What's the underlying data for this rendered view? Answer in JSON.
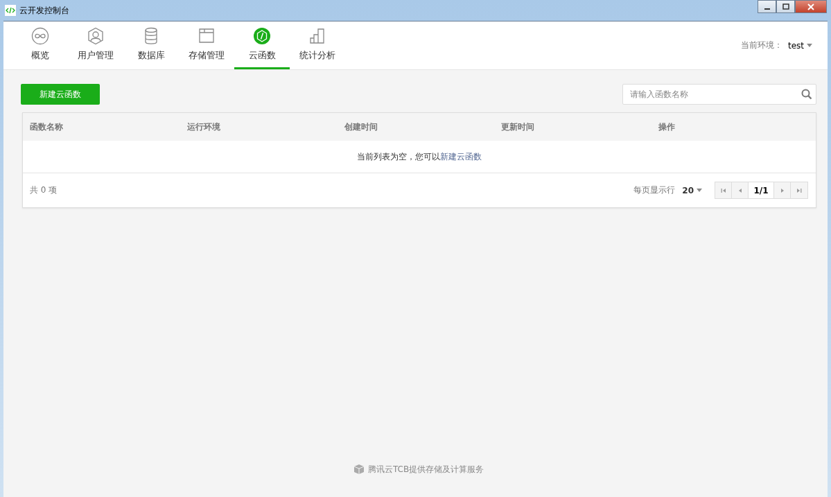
{
  "window": {
    "title": "云开发控制台"
  },
  "tabs": [
    {
      "label": "概览",
      "kind": "overview",
      "selected": false
    },
    {
      "label": "用户管理",
      "kind": "users",
      "selected": false
    },
    {
      "label": "数据库",
      "kind": "database",
      "selected": false
    },
    {
      "label": "存储管理",
      "kind": "storage",
      "selected": false
    },
    {
      "label": "云函数",
      "kind": "functions",
      "selected": true
    },
    {
      "label": "统计分析",
      "kind": "stats",
      "selected": false
    }
  ],
  "environment": {
    "label": "当前环境：",
    "value": "test"
  },
  "create_button": "新建云函数",
  "search": {
    "placeholder": "请输入函数名称"
  },
  "table": {
    "columns": [
      "函数名称",
      "运行环境",
      "创建时间",
      "更新时间",
      "操作"
    ],
    "empty_message": {
      "text": "当前列表为空，您可以",
      "link": "新建云函数"
    }
  },
  "footer": {
    "total": "共 0 项",
    "page_size_label": "每页显示行",
    "page_size": "20",
    "page": "1/1"
  },
  "credit": "腾讯云TCB提供存储及计算服务"
}
